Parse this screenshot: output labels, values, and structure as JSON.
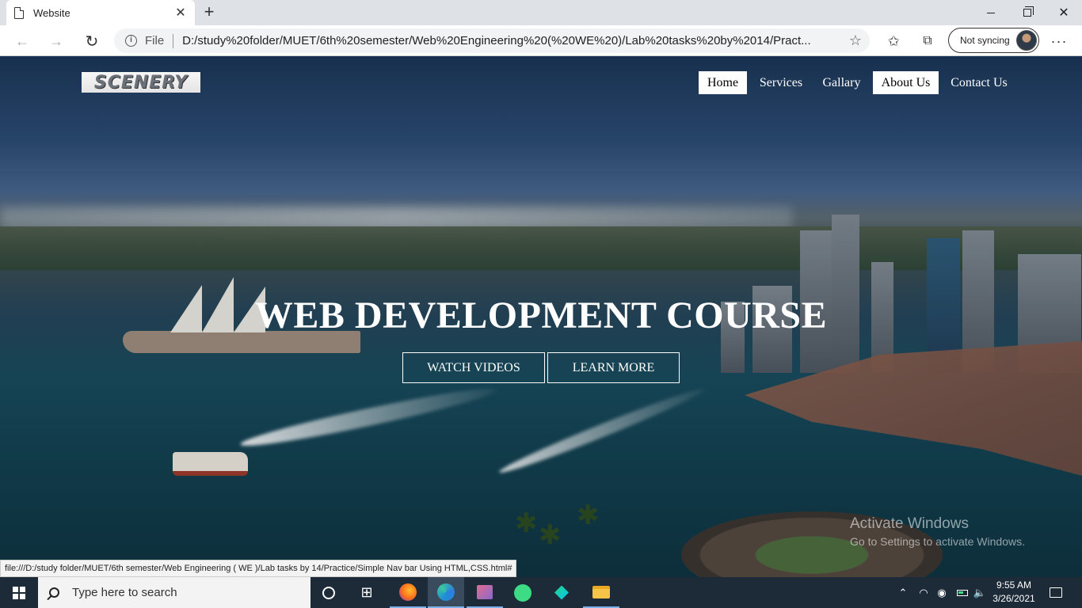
{
  "browser": {
    "tab_title": "Website",
    "tab_close": "✕",
    "new_tab": "+",
    "address_scheme_label": "File",
    "address_url": "D:/study%20folder/MUET/6th%20semester/Web%20Engineering%20(%20WE%20)/Lab%20tasks%20by%2014/Pract...",
    "sync_label": "Not syncing",
    "status_url": "file:///D:/study folder/MUET/6th semester/Web Engineering ( WE )/Lab tasks by 14/Practice/Simple Nav bar Using HTML,CSS.html#"
  },
  "site": {
    "logo_text": "SCENERY",
    "nav": [
      {
        "label": "Home",
        "active": true
      },
      {
        "label": "Services",
        "active": false
      },
      {
        "label": "Gallary",
        "active": false
      },
      {
        "label": "About Us",
        "active": true
      },
      {
        "label": "Contact Us",
        "active": false
      }
    ],
    "hero_title": "WEB DEVELOPMENT COURSE",
    "buttons": {
      "watch": "WATCH VIDEOS",
      "learn": "LEARN MORE"
    }
  },
  "watermark": {
    "line1": "Activate Windows",
    "line2": "Go to Settings to activate Windows."
  },
  "taskbar": {
    "search_placeholder": "Type here to search",
    "time": "9:55 AM",
    "date": "3/26/2021",
    "pinned": [
      "cortana",
      "task-view",
      "firefox",
      "edge",
      "paint",
      "android-studio",
      "pycharm",
      "file-explorer"
    ]
  },
  "colors": {
    "taskbar_bg": "#1d2a38",
    "nav_active_bg": "#ffffff",
    "accent": "#7ab1e8"
  }
}
